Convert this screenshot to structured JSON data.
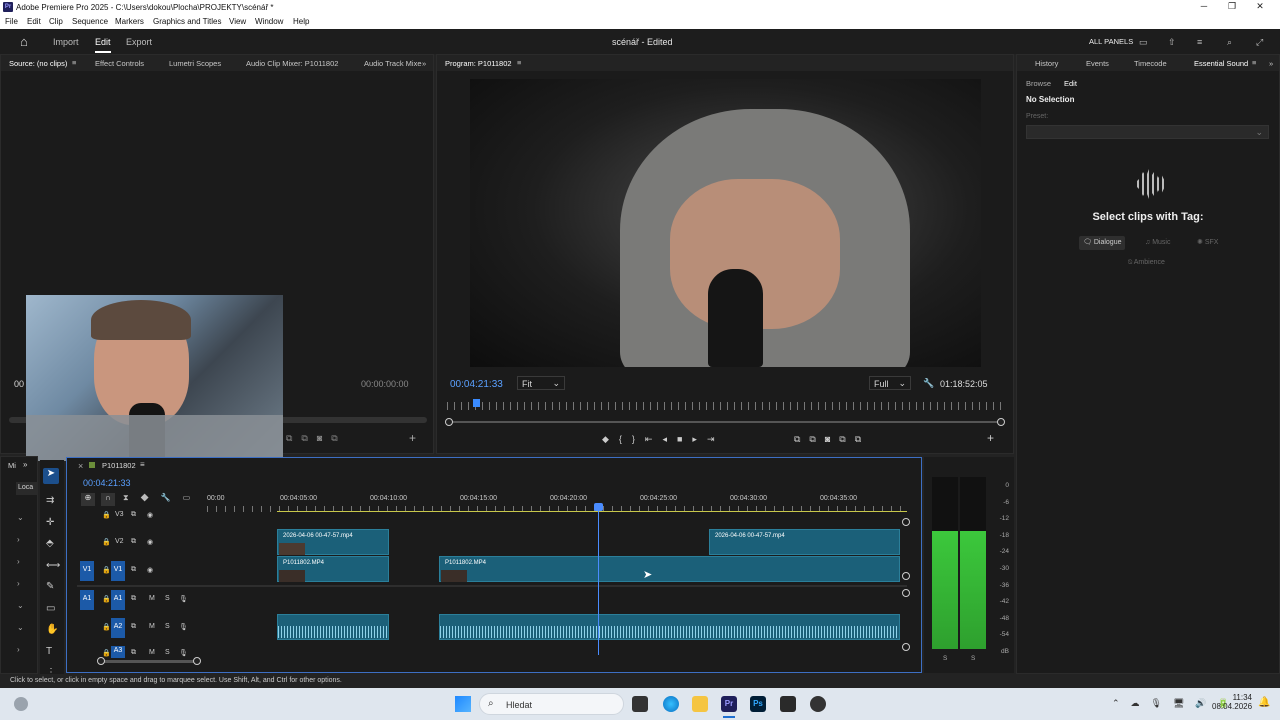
{
  "titlebar": {
    "title": "Adobe Premiere Pro 2025 - C:\\Users\\dokou\\Plocha\\PROJEKTY\\scénář *",
    "logo": "Pr"
  },
  "menu": [
    "File",
    "Edit",
    "Clip",
    "Sequence",
    "Markers",
    "Graphics and Titles",
    "View",
    "Window",
    "Help"
  ],
  "appbar": {
    "import": "Import",
    "edit": "Edit",
    "export": "Export",
    "project": "scénář - Edited",
    "all_panels": "ALL PANELS"
  },
  "source_tabs": [
    "Source: (no clips)",
    "Effect Controls",
    "Lumetri Scopes",
    "Audio Clip Mixer: P1011802",
    "Audio Track Mixe"
  ],
  "source_time_left": "00",
  "source_time_right": "00:00:00:00",
  "program": {
    "title": "Program: P1011802",
    "timecode": "00:04:21:33",
    "fit": "Fit",
    "quality": "Full",
    "duration": "01:18:52:05"
  },
  "right_tabs": [
    "History",
    "Events",
    "Timecode",
    "Essential Sound"
  ],
  "essential": {
    "browse": "Browse",
    "edit": "Edit",
    "no_selection": "No Selection",
    "preset": "Preset:",
    "select_tag": "Select clips with Tag:",
    "tags": [
      "Dialogue",
      "Music",
      "SFX",
      "Ambience"
    ]
  },
  "timeline": {
    "tab": "P1011802",
    "timecode": "00:04:21:33",
    "ruler": [
      "00:00",
      "00:04:05:00",
      "00:04:10:00",
      "00:04:15:00",
      "00:04:20:00",
      "00:04:25:00",
      "00:04:30:00",
      "00:04:35:00"
    ],
    "tracks": {
      "v3": "V3",
      "v2": "V2",
      "v1": "V1",
      "a1": "A1",
      "a2": "A2",
      "a3": "A3",
      "m": "M",
      "s": "S"
    },
    "clips": {
      "v2a": "2026-04-06 00-47-57.mp4",
      "v2b": "2026-04-06 00-47-57.mp4",
      "v1a": "P1011802.MP4",
      "v1b": "P1011802.MP4"
    }
  },
  "meter_scale": [
    "0",
    "-6",
    "-12",
    "-18",
    "-24",
    "-30",
    "-36",
    "-42",
    "-48",
    "-54",
    "dB"
  ],
  "meter_solo": [
    "S",
    "S"
  ],
  "project_panel": {
    "tab": "Mi",
    "loca": "Loca"
  },
  "status": "Click to select, or click in empty space and drag to marquee select. Use Shift, Alt, and Ctrl for other options.",
  "taskbar": {
    "search": "Hledat",
    "time": "11:34",
    "date": "08.04.2026"
  }
}
